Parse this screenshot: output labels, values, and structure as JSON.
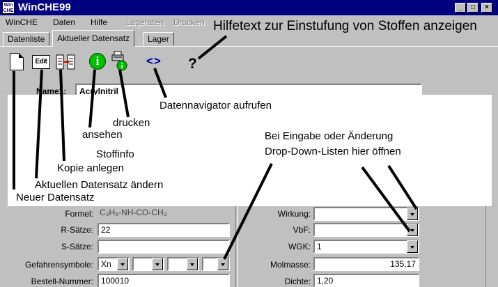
{
  "window": {
    "logo_top": "Win",
    "logo_bottom": "CHE",
    "title": "WinCHE99",
    "minimize": "_",
    "maximize": "□",
    "close": "×"
  },
  "menu": {
    "items": [
      "WinCHE",
      "Daten",
      "Hilfe",
      "Lageraten",
      "Drucken"
    ]
  },
  "tabs": [
    "Datenliste",
    "Aktueller Datensatz",
    "Lager"
  ],
  "toolbar": {
    "edit_label": "Edit",
    "view_glyph": "i",
    "nav_glyph": "<>",
    "help_glyph": "?"
  },
  "record": {
    "name_label": "Name1:",
    "name_value": "Acrylnitril"
  },
  "annotations": {
    "help": "Hilfetext zur Einstufung von Stoffen anzeigen",
    "navigator": "Datennavigator aufrufen",
    "print": "drucken",
    "view": "ansehen",
    "stoffinfo": "Stoffinfo",
    "copy": "Kopie anlegen",
    "edit": "Aktuellen Datensatz ändern",
    "new": "Neuer Datensatz",
    "dropdown_line1": "Bei Eingabe oder Änderung",
    "dropdown_line2": "Drop-Down-Listen hier öffnen"
  },
  "form_left": {
    "formel_label": "Formel:",
    "formel_value": "C₃H₅-NH-CO-CH₃",
    "rsaetze_label": "R-Sätze:",
    "rsaetze_value": "22",
    "ssaetze_label": "S-Sätze:",
    "ssaetze_value": "",
    "gefahren_label": "Gefahrensymbole:",
    "gefahren_value": "Xn",
    "bestell_label": "Bestell-Nummer:",
    "bestell_value": "100010"
  },
  "form_right": {
    "wirkung_label": "Wirkung:",
    "wirkung_value": "",
    "vbf_label": "VbF:",
    "vbf_value": "",
    "wgk_label": "WGK:",
    "wgk_value": "1",
    "molmasse_label": "Molmasse:",
    "molmasse_value": "135,17",
    "dichte_label": "Dichte:",
    "dichte_value": "1,20"
  },
  "colors": {
    "titlebar": "#000080",
    "face": "#c0c0c0",
    "view_icon": "#00c000",
    "nav_icon": "#0000a0"
  }
}
